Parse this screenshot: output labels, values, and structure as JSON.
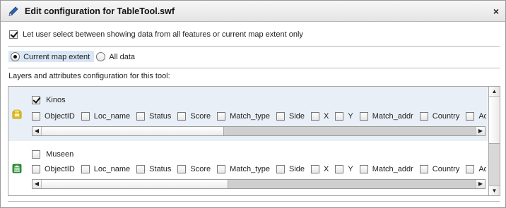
{
  "window": {
    "title": "Edit configuration for TableTool.swf",
    "title_icon": "pencil-icon",
    "close_glyph": "×"
  },
  "options": {
    "allow_switch_label": "Let user select between showing data from all features or current map extent only",
    "allow_switch_checked": true,
    "extent_options": [
      {
        "label": "Current map extent",
        "selected": true
      },
      {
        "label": "All data",
        "selected": false
      }
    ]
  },
  "layers_section": {
    "heading": "Layers and attributes configuration for this tool:",
    "layers": [
      {
        "name": "Kinos",
        "checked": true,
        "icon": "cinema-layer-icon",
        "attributes": [
          "ObjectID",
          "Loc_name",
          "Status",
          "Score",
          "Match_type",
          "Side",
          "X",
          "Y",
          "Match_addr",
          "Country",
          "Admin_N"
        ],
        "scroll_position": 0.0,
        "scroll_visible_fraction": 0.42
      },
      {
        "name": "Museen",
        "checked": false,
        "icon": "museum-layer-icon",
        "attributes": [
          "ObjectID",
          "Loc_name",
          "Status",
          "Score",
          "Match_type",
          "Side",
          "X",
          "Y",
          "Match_addr",
          "Country",
          "Admin_N"
        ],
        "scroll_position": 0.0,
        "scroll_visible_fraction": 0.43
      }
    ],
    "vertical_scroll_visible_fraction": 0.53
  },
  "glyphs": {
    "arrow_left": "◀",
    "arrow_right": "▶",
    "arrow_up": "▲",
    "arrow_down": "▼"
  },
  "colors": {
    "selected_layer_bg": "#e9eff6",
    "selected_option_bg": "#d9e6f5",
    "kinos_icon": "#e8c020",
    "museen_icon": "#2e9a3a"
  }
}
